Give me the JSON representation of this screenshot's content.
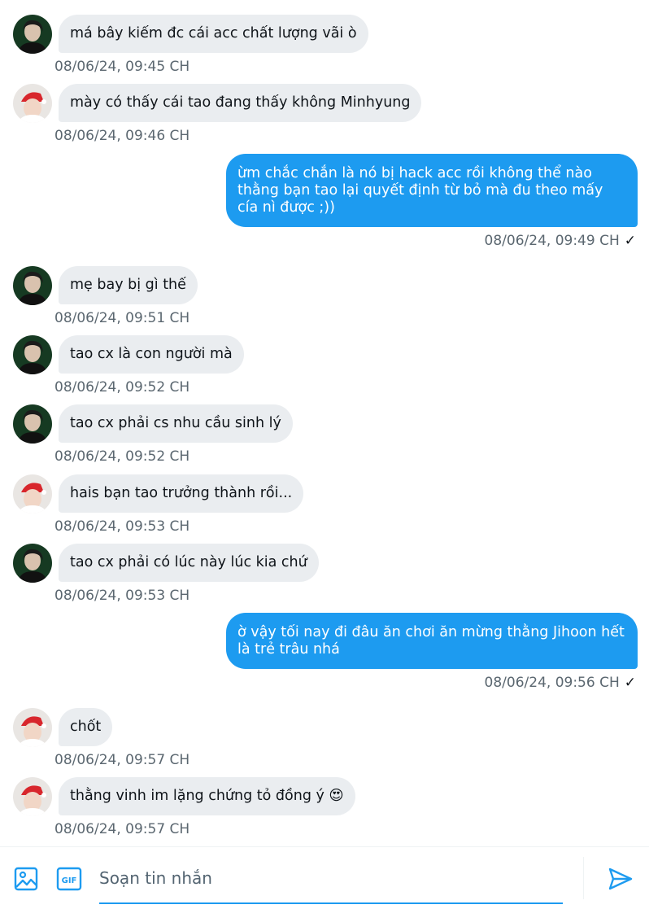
{
  "thread": {
    "messages": [
      {
        "side": "in",
        "avatar": "avatar-green",
        "text": "má bây kiếm đc cái acc chất lượng vãi ò",
        "time": "08/06/24, 09:45 CH"
      },
      {
        "side": "in",
        "avatar": "avatar-santa",
        "text": "mày có thấy cái tao đang thấy không Minhyung",
        "time": "08/06/24, 09:46 CH"
      },
      {
        "side": "out",
        "text": "ừm chắc chắn là nó bị hack acc rồi không thể nào thằng bạn tao lại quyết định từ bỏ mà đu theo mấy cía nì được ;))",
        "time": "08/06/24, 09:49 CH",
        "status": "✓"
      },
      {
        "side": "in",
        "avatar": "avatar-green",
        "text": "mẹ bay bị gì thế",
        "time": "08/06/24, 09:51 CH"
      },
      {
        "side": "in",
        "avatar": "avatar-green",
        "text": "tao cx là con người mà",
        "time": "08/06/24, 09:52 CH"
      },
      {
        "side": "in",
        "avatar": "avatar-green",
        "text": "tao cx phải cs nhu cầu sinh lý",
        "time": "08/06/24, 09:52 CH"
      },
      {
        "side": "in",
        "avatar": "avatar-santa",
        "text": "hais bạn tao trưởng thành rồi...",
        "time": "08/06/24, 09:53 CH"
      },
      {
        "side": "in",
        "avatar": "avatar-green",
        "text": "tao cx phải có lúc này lúc kia chứ",
        "time": "08/06/24, 09:53 CH"
      },
      {
        "side": "out",
        "text": "ờ vậy tối nay đi đâu ăn chơi ăn mừng thằng Jihoon hết là trẻ trâu nhá",
        "time": "08/06/24, 09:56 CH",
        "status": "✓"
      },
      {
        "side": "in",
        "avatar": "avatar-santa",
        "text": "chốt",
        "time": "08/06/24, 09:57 CH"
      },
      {
        "side": "in",
        "avatar": "avatar-santa",
        "text": "thằng vinh im lặng chứng tỏ đồng ý 😍",
        "time": "08/06/24, 09:57 CH"
      }
    ]
  },
  "composer": {
    "placeholder": "Soạn tin nhắn",
    "value": "",
    "gif_label": "GIF",
    "icons": {
      "media": "image-icon",
      "gif": "gif-icon",
      "send": "send-icon"
    },
    "accent": "#1d9bf0"
  },
  "colors": {
    "incoming_bubble": "#eaedf0",
    "outgoing_bubble": "#1d9bf0",
    "timestamp": "#5b6770"
  }
}
